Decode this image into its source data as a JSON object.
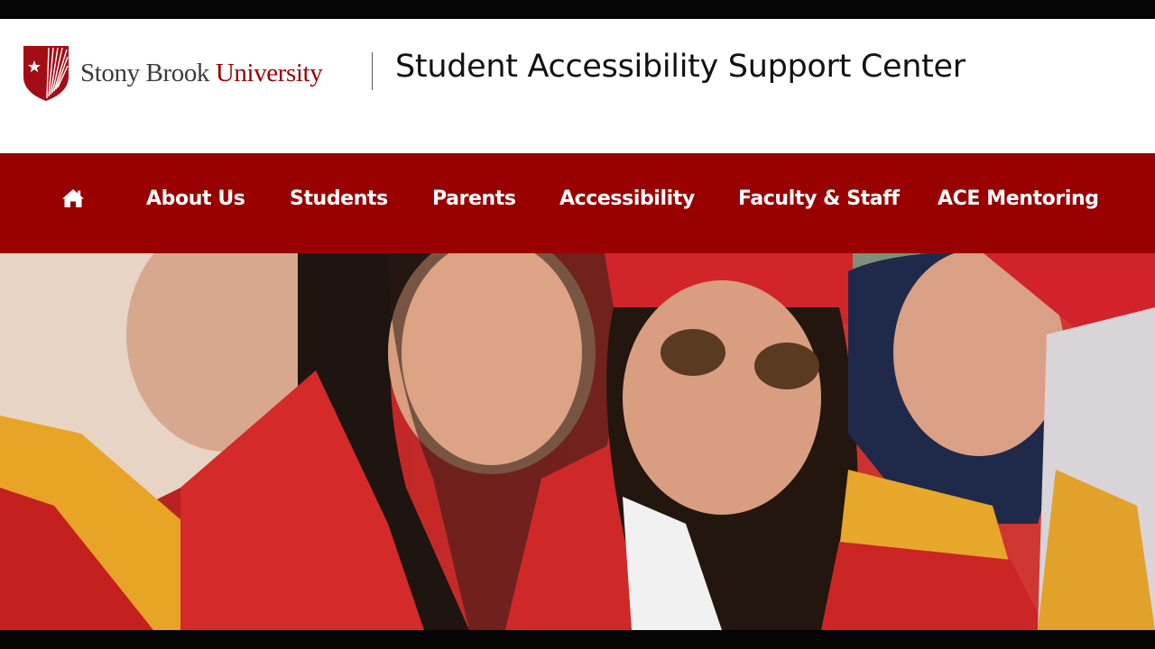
{
  "header": {
    "university": {
      "part1": "Stony Brook ",
      "part2": "University"
    },
    "site_title": "Student Accessibility Support Center"
  },
  "nav": {
    "home_icon": "home-icon",
    "items": [
      {
        "label": "About Us"
      },
      {
        "label": "Students"
      },
      {
        "label": "Parents"
      },
      {
        "label": "Accessibility"
      },
      {
        "label": "Faculty & Staff"
      },
      {
        "label": "ACE Mentoring"
      }
    ]
  },
  "colors": {
    "brand_red": "#990000",
    "header_bg": "#ffffff",
    "nav_text": "#ffffff"
  },
  "hero": {
    "image": "graduates-photo"
  }
}
